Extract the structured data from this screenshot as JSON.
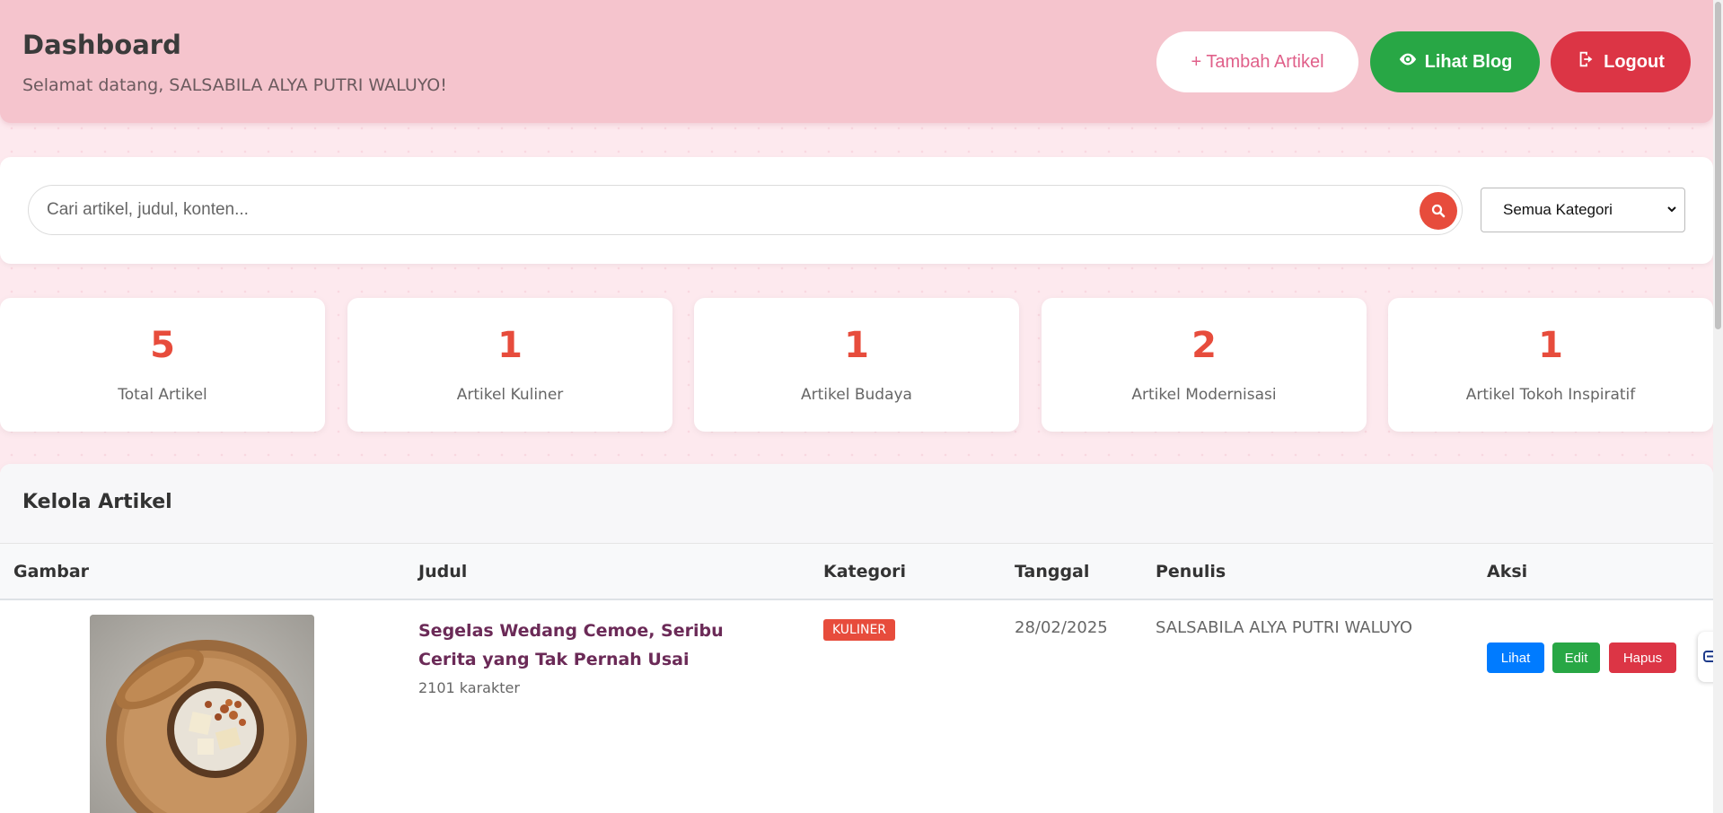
{
  "header": {
    "title": "Dashboard",
    "welcome": "Selamat datang, SALSABILA ALYA PUTRI WALUYO!",
    "add_article": "+ Tambah Artikel",
    "view_blog": "Lihat Blog",
    "logout": "Logout"
  },
  "search": {
    "placeholder": "Cari artikel, judul, konten...",
    "category_selected": "Semua Kategori"
  },
  "stats": [
    {
      "value": "5",
      "label": "Total Artikel"
    },
    {
      "value": "1",
      "label": "Artikel Kuliner"
    },
    {
      "value": "1",
      "label": "Artikel Budaya"
    },
    {
      "value": "2",
      "label": "Artikel Modernisasi"
    },
    {
      "value": "1",
      "label": "Artikel Tokoh Inspiratif"
    }
  ],
  "table": {
    "title": "Kelola Artikel",
    "columns": [
      "Gambar",
      "Judul",
      "Kategori",
      "Tanggal",
      "Penulis",
      "Aksi"
    ],
    "rows": [
      {
        "title": "Segelas Wedang Cemoe, Seribu Cerita yang Tak Pernah Usai",
        "chars": "2101 karakter",
        "category": "KULINER",
        "date": "28/02/2025",
        "author": "SALSABILA ALYA PUTRI WALUYO",
        "actions": {
          "view": "Lihat",
          "edit": "Edit",
          "delete": "Hapus"
        }
      }
    ]
  },
  "colors": {
    "header_bg": "#f5c4cd",
    "accent_red": "#e74c3c",
    "green": "#28a745",
    "danger": "#dc3545",
    "blue": "#007bff",
    "title_link": "#6b2a57"
  },
  "icons": {
    "view_blog": "eye-icon",
    "logout": "sign-out-icon",
    "search": "search-icon",
    "category": "chevron-down-icon"
  }
}
